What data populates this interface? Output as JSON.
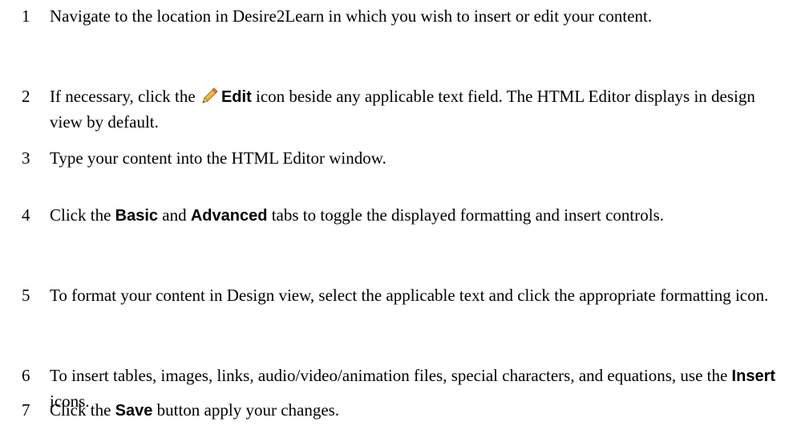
{
  "steps": [
    {
      "number": "1",
      "segments": [
        {
          "type": "text",
          "text": "Navigate to the location in Desire2Learn in which you wish to insert or edit your content."
        }
      ]
    },
    {
      "number": "2",
      "segments": [
        {
          "type": "text",
          "text": "If necessary, click the "
        },
        {
          "type": "icon",
          "icon": "pencil-icon"
        },
        {
          "type": "ui",
          "text": "Edit"
        },
        {
          "type": "text",
          "text": " icon beside any applicable text field. The HTML Editor displays in design view by default."
        }
      ]
    },
    {
      "number": "3",
      "segments": [
        {
          "type": "text",
          "text": "Type your content into the HTML Editor window."
        }
      ]
    },
    {
      "number": "4",
      "segments": [
        {
          "type": "text",
          "text": "Click the "
        },
        {
          "type": "ui",
          "text": "Basic"
        },
        {
          "type": "text",
          "text": " and "
        },
        {
          "type": "ui",
          "text": "Advanced"
        },
        {
          "type": "text",
          "text": " tabs to toggle the displayed formatting and insert controls."
        }
      ]
    },
    {
      "number": "5",
      "segments": [
        {
          "type": "text",
          "text": "To format your content in Design view, select the applicable text and click the appropriate formatting icon."
        }
      ]
    },
    {
      "number": "6",
      "segments": [
        {
          "type": "text",
          "text": "To insert tables, images, links, audio/video/animation files, special characters, and equations, use the "
        },
        {
          "type": "ui",
          "text": "Insert"
        },
        {
          "type": "text",
          "text": " icons."
        }
      ]
    },
    {
      "number": "7",
      "segments": [
        {
          "type": "text",
          "text": "Click the "
        },
        {
          "type": "ui",
          "text": "Save"
        },
        {
          "type": "text",
          "text": " button apply your changes."
        }
      ]
    }
  ]
}
